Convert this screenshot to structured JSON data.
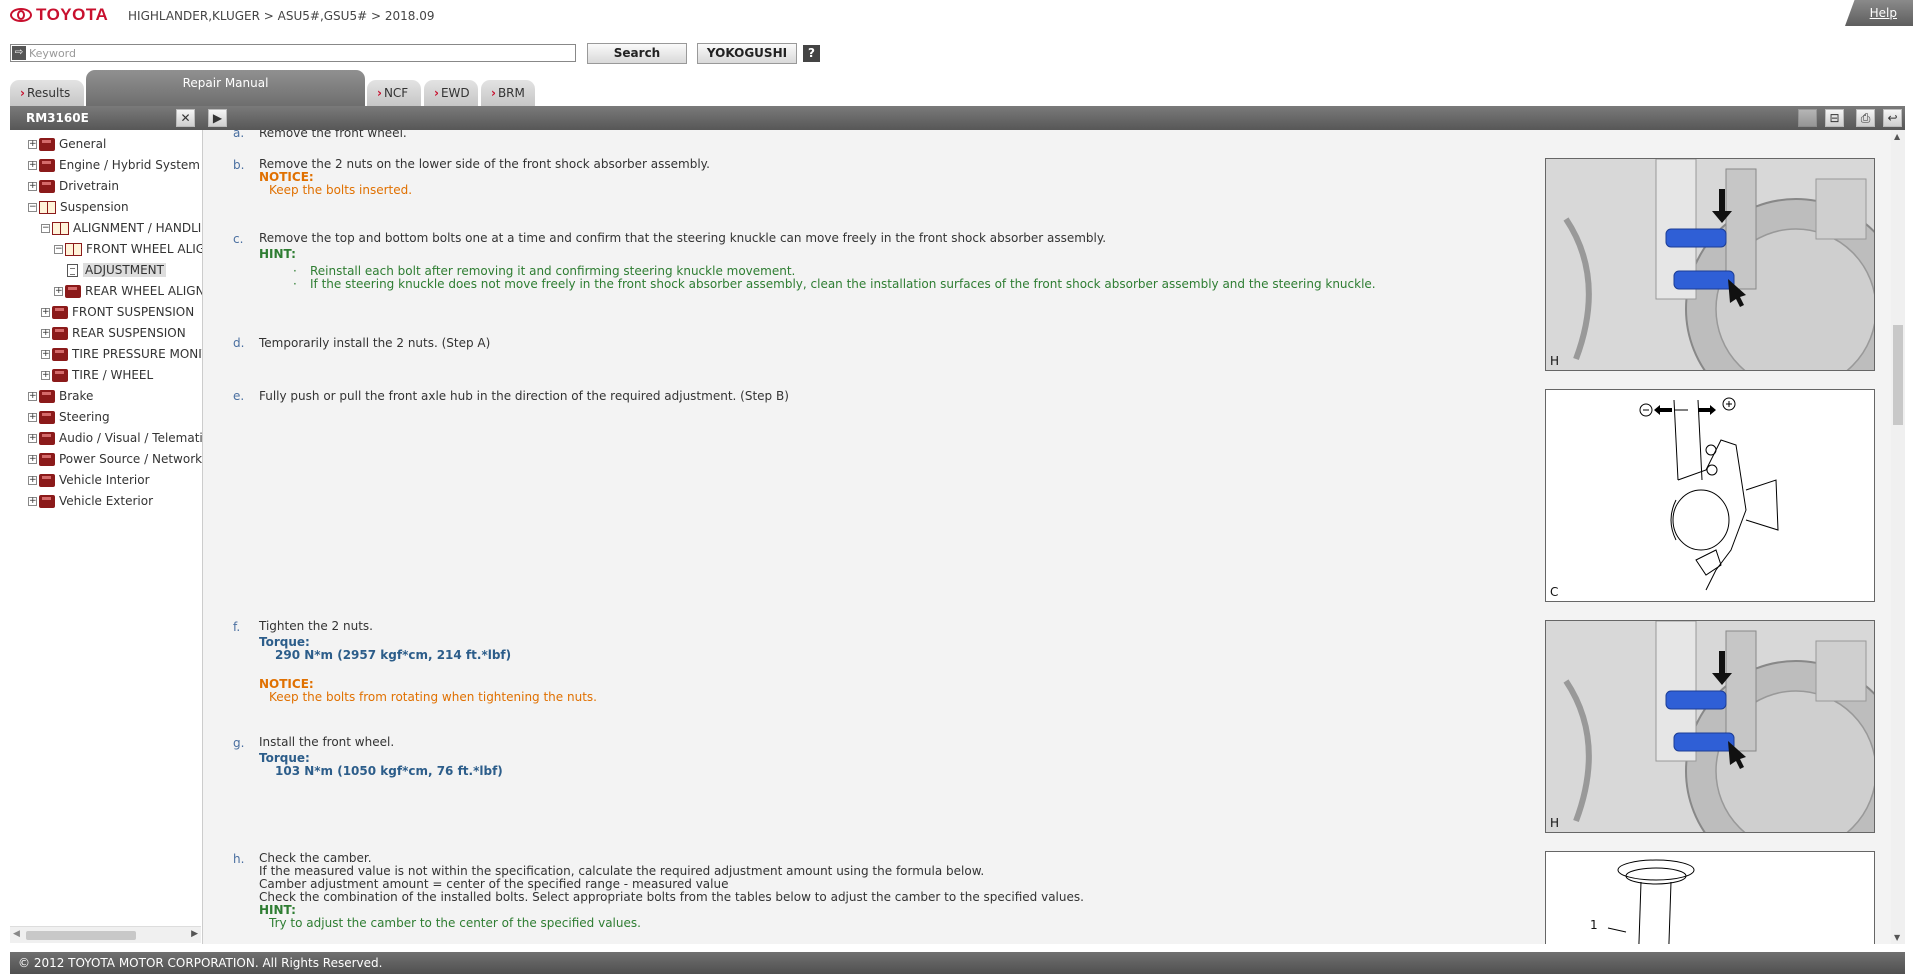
{
  "header": {
    "brand": "TOYOTA",
    "breadcrumb": "HIGHLANDER,KLUGER > ASU5#,GSU5# > 2018.09",
    "help": "Help"
  },
  "search": {
    "placeholder": "Keyword",
    "search_label": "Search",
    "yokogushi_label": "YOKOGUSHI",
    "help_icon": "?"
  },
  "tabs": [
    {
      "label": "Results"
    },
    {
      "label": "Repair Manual"
    },
    {
      "label": "NCF"
    },
    {
      "label": "EWD"
    },
    {
      "label": "BRM"
    }
  ],
  "titlebar": {
    "code": "RM3160E"
  },
  "tree": [
    {
      "label": "General"
    },
    {
      "label": "Engine / Hybrid System"
    },
    {
      "label": "Drivetrain"
    },
    {
      "label": "Suspension"
    },
    {
      "label": "ALIGNMENT / HANDLIN"
    },
    {
      "label": "FRONT WHEEL ALIGN"
    },
    {
      "label": "ADJUSTMENT"
    },
    {
      "label": "REAR WHEEL ALIGNM"
    },
    {
      "label": "FRONT SUSPENSION"
    },
    {
      "label": "REAR SUSPENSION"
    },
    {
      "label": "TIRE PRESSURE MONIT"
    },
    {
      "label": "TIRE / WHEEL"
    },
    {
      "label": "Brake"
    },
    {
      "label": "Steering"
    },
    {
      "label": "Audio / Visual / Telematic"
    },
    {
      "label": "Power Source / Network"
    },
    {
      "label": "Vehicle Interior"
    },
    {
      "label": "Vehicle Exterior"
    }
  ],
  "content": {
    "a": {
      "label": "a.",
      "text": "Remove the front wheel."
    },
    "b": {
      "label": "b.",
      "text": "Remove the 2 nuts on the lower side of the front shock absorber assembly.",
      "notice_h": "NOTICE:",
      "notice": "Keep the bolts inserted."
    },
    "c": {
      "label": "c.",
      "text": "Remove the top and bottom bolts one at a time and confirm that the steering knuckle can move freely in the front shock absorber assembly.",
      "hint_h": "HINT:",
      "hint1": "Reinstall each bolt after removing it and confirming steering knuckle movement.",
      "hint2": "If the steering knuckle does not move freely in the front shock absorber assembly, clean the installation surfaces of the front shock absorber assembly and the steering knuckle."
    },
    "d": {
      "label": "d.",
      "text": "Temporarily install the 2 nuts. (Step A)"
    },
    "e": {
      "label": "e.",
      "text": "Fully push or pull the front axle hub in the direction of the required adjustment. (Step B)"
    },
    "f": {
      "label": "f.",
      "text": "Tighten the 2 nuts.",
      "torque_h": "Torque:",
      "torque": "290 N*m (2957 kgf*cm, 214 ft.*lbf)",
      "notice_h": "NOTICE:",
      "notice": "Keep the bolts from rotating when tightening the nuts."
    },
    "g": {
      "label": "g.",
      "text": "Install the front wheel.",
      "torque_h": "Torque:",
      "torque": "103 N*m (1050 kgf*cm, 76 ft.*lbf)"
    },
    "h": {
      "label": "h.",
      "text": "Check the camber.",
      "line2": "If the measured value is not within the specification, calculate the required adjustment amount using the formula below.",
      "line3": "Camber adjustment amount = center of the specified range - measured value",
      "line4": "Check the combination of the installed bolts. Select appropriate bolts from the tables below to adjust the camber to the specified values.",
      "hint_h": "HINT:",
      "hint": "Try to adjust the camber to the center of the specified values."
    },
    "figures": {
      "f1": "H",
      "f2": "C",
      "f3": "H",
      "f4_callout": "1"
    }
  },
  "footer": {
    "copyright": "© 2012 TOYOTA MOTOR CORPORATION. All Rights Reserved."
  }
}
